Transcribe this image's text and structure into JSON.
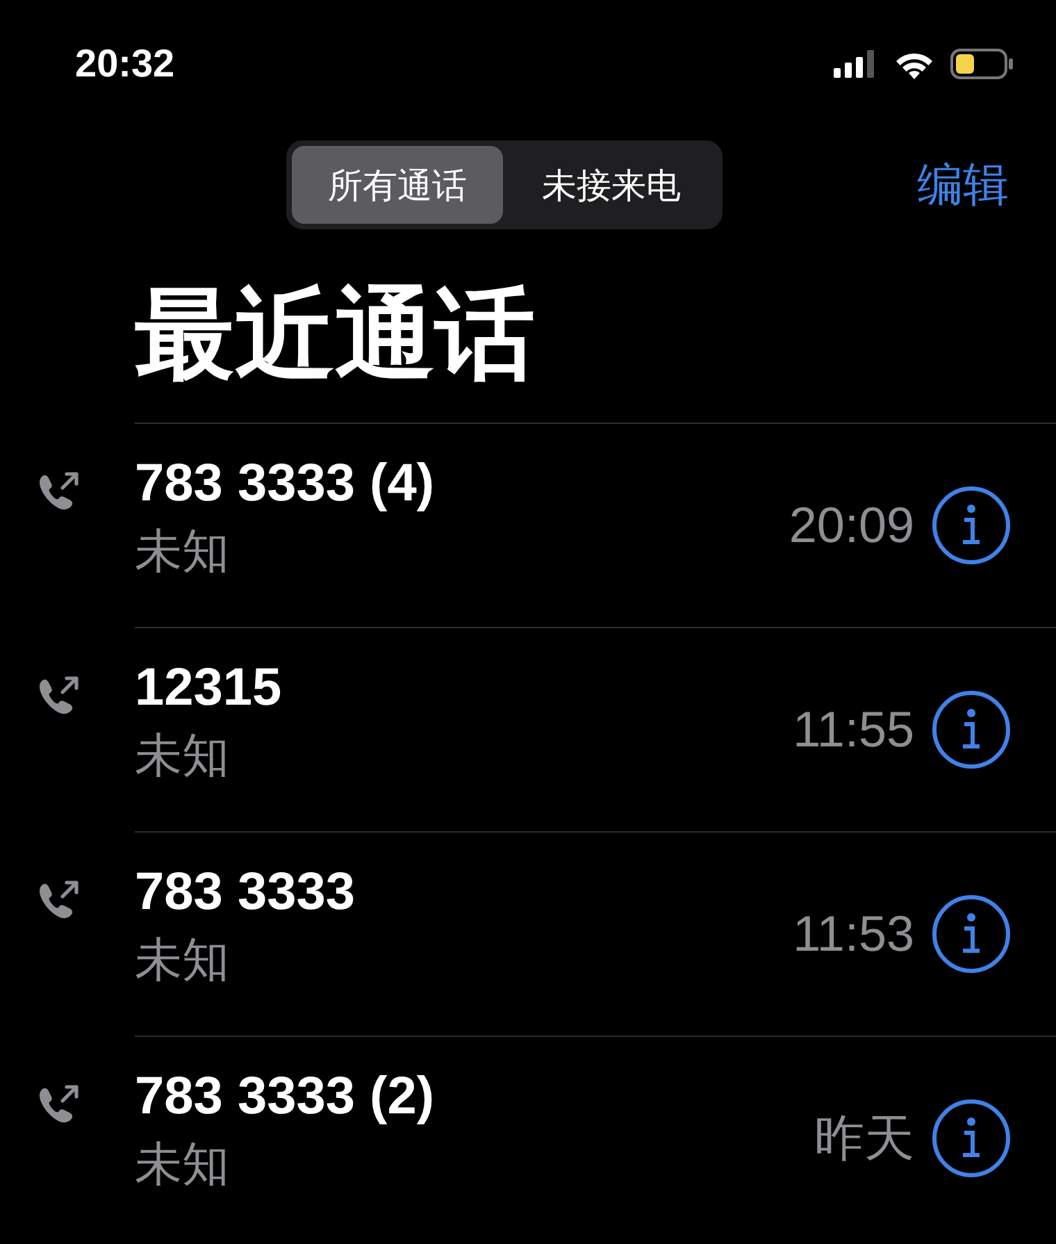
{
  "status_bar": {
    "time": "20:32"
  },
  "segments": [
    {
      "label": "所有通话",
      "selected": true
    },
    {
      "label": "未接来电",
      "selected": false
    }
  ],
  "edit_button": "编辑",
  "title": "最近通话",
  "calls": [
    {
      "number": "783 3333 (4)",
      "label": "未知",
      "time": "20:09"
    },
    {
      "number": "12315",
      "label": "未知",
      "time": "11:55"
    },
    {
      "number": "783 3333",
      "label": "未知",
      "time": "11:53"
    },
    {
      "number": "783 3333 (2)",
      "label": "未知",
      "time": "昨天"
    }
  ]
}
